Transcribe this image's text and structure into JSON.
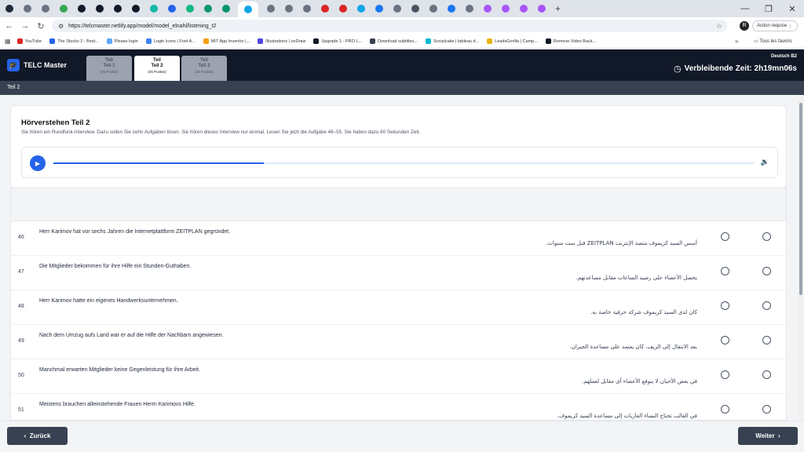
{
  "browser": {
    "url": "https://telcmaster.netlify.app/model/model_elnahl/listening_t2",
    "action_button": "Action requise",
    "profile_initial": "R",
    "tabs": [
      {
        "label": "B",
        "color": "#1f2937"
      },
      {
        "label": "",
        "color": "#6b7280"
      },
      {
        "label": "",
        "color": "#6b7280"
      },
      {
        "label": "",
        "color": "#34a853"
      },
      {
        "label": "",
        "color": "#111827"
      },
      {
        "label": "",
        "color": "#111827"
      },
      {
        "label": "",
        "color": "#111827"
      },
      {
        "label": "",
        "color": "#111827"
      },
      {
        "label": "",
        "color": "#14b8a6"
      },
      {
        "label": "",
        "color": "#2563eb"
      },
      {
        "label": "",
        "color": "#10b981"
      },
      {
        "label": "",
        "color": "#059669"
      },
      {
        "label": "",
        "color": "#059669"
      },
      {
        "label": "",
        "color": "#0ea5e9"
      },
      {
        "label": "",
        "color": "#6b7280"
      },
      {
        "label": "",
        "color": "#6b7280"
      },
      {
        "label": "",
        "color": "#6b7280"
      },
      {
        "label": "",
        "color": "#dc2626"
      },
      {
        "label": "",
        "color": "#dc2626"
      },
      {
        "label": "",
        "color": "#0ea5e9"
      },
      {
        "label": "",
        "color": "#1877f2"
      },
      {
        "label": "",
        "color": "#6b7280"
      },
      {
        "label": "",
        "color": "#4b5563"
      },
      {
        "label": "",
        "color": "#6b7280"
      },
      {
        "label": "",
        "color": "#1877f2"
      },
      {
        "label": "",
        "color": "#6b7280"
      },
      {
        "label": "",
        "color": "#a855f7"
      },
      {
        "label": "",
        "color": "#a855f7"
      },
      {
        "label": "",
        "color": "#a855f7"
      },
      {
        "label": "",
        "color": "#a855f7"
      }
    ],
    "bookmarks": [
      {
        "label": "YouTube",
        "color": "#dc2626"
      },
      {
        "label": "The Stocks 2 - Best...",
        "color": "#2563eb"
      },
      {
        "label": "Please login",
        "color": "#60a5fa"
      },
      {
        "label": "Login Icons | Font A...",
        "color": "#3b82f6"
      },
      {
        "label": "MIT App Inventor |...",
        "color": "#f59e0b"
      },
      {
        "label": "Illustrations | unDraw",
        "color": "#4f46e5"
      },
      {
        "label": "Upgrade 1 - PRO L...",
        "color": "#111827"
      },
      {
        "label": "Download subtitles...",
        "color": "#374151"
      },
      {
        "label": "Socialcake | tableau d...",
        "color": "#06b6d4"
      },
      {
        "label": "LeadsGorilla | Camp...",
        "color": "#eab308"
      },
      {
        "label": "Remove Video Back...",
        "color": "#111827"
      }
    ],
    "all_bookmarks": "Tous les favoris"
  },
  "app": {
    "name": "TELC Master",
    "language": "Deutsch B2",
    "timer": "Verbleibende Zeit: 2h19mn06s",
    "parts": [
      {
        "l1": "Teil",
        "l2": "Teil 1",
        "l3": "(25 Punkte)",
        "active": false
      },
      {
        "l1": "Teil",
        "l2": "Teil 2",
        "l3": "(25 Punkte)",
        "active": true
      },
      {
        "l1": "Teil",
        "l2": "Teil 3",
        "l3": "(25 Punkte)",
        "active": false
      }
    ],
    "subheader": "Teil 2"
  },
  "section": {
    "title": "Hörverstehen Teil 2",
    "instructions": "Sie hören ein Rundfunk-Interview. Dazu sollen Sie zehn Aufgaben lösen. Sie hören dieses Interview nur einmal. Lesen Sie jetzt die Aufgabe 46–55. Sie haben dazu 60 Sekunden Zeit.",
    "audio_progress": 0.3
  },
  "questions": [
    {
      "num": "46",
      "de": "Herr Karimov hat vor sechs Jahren die Internetplattform ZEITPLAN gegründet.",
      "ar": "أسس السيد كريموف منصة الإنترنت ZEITPLAN قبل ست سنوات."
    },
    {
      "num": "47",
      "de": "Die Mitglieder bekommen für ihre Hilfe ein Stunden-Guthaben.",
      "ar": "يحصل الأعضاء على رصيد الساعات مقابل مساعدتهم."
    },
    {
      "num": "48",
      "de": "Herr Karimov hatte ein eigenes Handwerksunternehmen.",
      "ar": "كان لدى السيد كريموف شركة حرفية خاصة به."
    },
    {
      "num": "49",
      "de": "Nach dem Umzug aufs Land war er auf die Hilfe der Nachbarn angewiesen.",
      "ar": "بعد الانتقال إلى الريف، كان يعتمد على مساعدة الجيران."
    },
    {
      "num": "50",
      "de": "Manchmal erwarten Mitglieder keine Gegenleistung für ihre Arbeit.",
      "ar": "في بعض الأحيان لا يتوقع الأعضاء أي مقابل لعملهم."
    },
    {
      "num": "51",
      "de": "Meistens brauchen alleinstehende Frauen Herrn Karimovs Hilfe.",
      "ar": "في الغالب تحتاج النساء العازبات إلى مساعدة السيد كريموف."
    }
  ],
  "nav": {
    "prev": "Zurück",
    "next": "Weiter"
  }
}
